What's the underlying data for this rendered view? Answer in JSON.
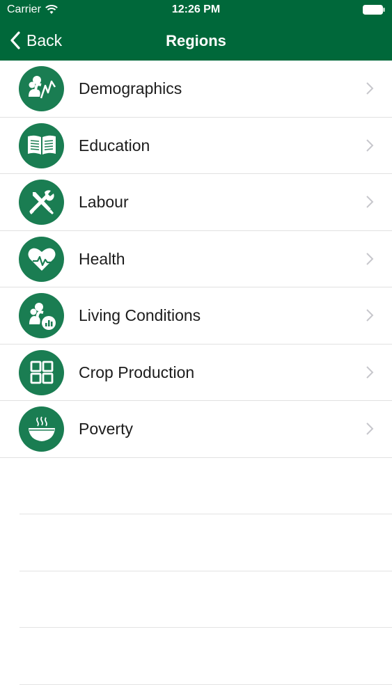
{
  "status_bar": {
    "carrier": "Carrier",
    "time": "12:26 PM"
  },
  "nav": {
    "back_label": "Back",
    "title": "Regions"
  },
  "colors": {
    "header": "#00683a",
    "icon_circle": "#1a7d52",
    "chevron": "#c7c7cc",
    "separator": "#e1e1e1"
  },
  "rows": [
    {
      "label": "Demographics",
      "icon": "demographics-icon"
    },
    {
      "label": "Education",
      "icon": "open-book-icon"
    },
    {
      "label": "Labour",
      "icon": "tools-icon"
    },
    {
      "label": "Health",
      "icon": "heart-pulse-icon"
    },
    {
      "label": "Living Conditions",
      "icon": "people-chart-icon"
    },
    {
      "label": "Crop Production",
      "icon": "grid-icon"
    },
    {
      "label": "Poverty",
      "icon": "bowl-icon"
    }
  ]
}
